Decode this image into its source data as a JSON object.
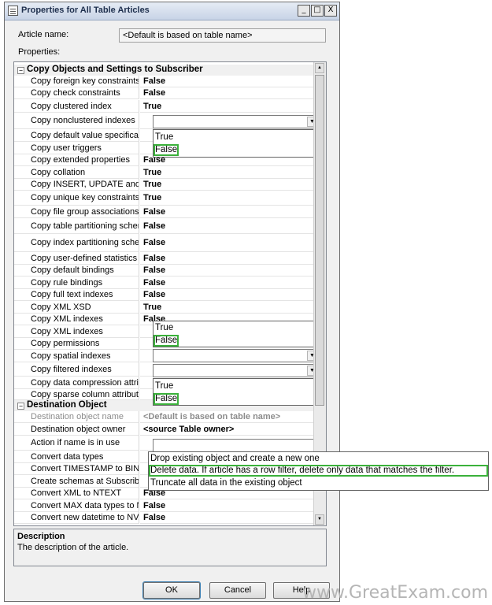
{
  "window": {
    "title": "Properties for All Table Articles",
    "caption_buttons": [
      "_",
      "□",
      "X"
    ]
  },
  "article_name": {
    "label": "Article name:",
    "value": "<Default is based on table name>"
  },
  "properties_label": "Properties:",
  "categories": [
    {
      "name": "Copy Objects and Settings to Subscriber",
      "toggle": "⊟"
    },
    {
      "name": "Destination Object",
      "toggle": "⊟"
    }
  ],
  "copy_rows": [
    {
      "name": "Copy foreign key constraints",
      "value": "False"
    },
    {
      "name": "Copy check constraints",
      "value": "False"
    },
    {
      "name": "Copy clustered index",
      "value": "True"
    },
    {
      "name": "Copy nonclustered indexes",
      "value": ""
    },
    {
      "name": "Copy default value specifications",
      "value": ""
    },
    {
      "name": "Copy user triggers",
      "value": ""
    },
    {
      "name": "Copy extended properties",
      "value": "False"
    },
    {
      "name": "Copy collation",
      "value": "True"
    },
    {
      "name": "Copy INSERT, UPDATE and DELETE",
      "value": "True"
    },
    {
      "name": "Copy unique key constraints",
      "value": "True"
    },
    {
      "name": "Copy file group associations",
      "value": "False"
    },
    {
      "name": "Copy table partitioning schemes",
      "value": "False"
    },
    {
      "name": "Copy index partitioning schemes",
      "value": "False"
    },
    {
      "name": "Copy user-defined statistics",
      "value": "False"
    },
    {
      "name": "Copy default bindings",
      "value": "False"
    },
    {
      "name": "Copy rule bindings",
      "value": "False"
    },
    {
      "name": "Copy full text indexes",
      "value": "False"
    },
    {
      "name": "Copy XML XSD",
      "value": "True"
    },
    {
      "name": "Copy XML indexes",
      "value": "False"
    },
    {
      "name": "Copy XML indexes",
      "value": ""
    },
    {
      "name": "Copy permissions",
      "value": ""
    },
    {
      "name": "Copy spatial indexes",
      "value": ""
    },
    {
      "name": "Copy filtered indexes",
      "value": ""
    },
    {
      "name": "Copy data compression attributes",
      "value": ""
    },
    {
      "name": "Copy sparse column attribute",
      "value": ""
    }
  ],
  "dest_rows": [
    {
      "name": "Destination object name",
      "value": "<Default is based on table name>"
    },
    {
      "name": "Destination object owner",
      "value": "<source Table owner>"
    },
    {
      "name": "Action if name is in use",
      "value": ""
    },
    {
      "name": "Convert data types",
      "value": ""
    },
    {
      "name": "Convert TIMESTAMP to BINARY",
      "value": ""
    },
    {
      "name": "Create schemas at Subscriber",
      "value": ""
    },
    {
      "name": "Convert XML to NTEXT",
      "value": "False"
    },
    {
      "name": "Convert MAX data types to NTEXT",
      "value": "False"
    },
    {
      "name": "Convert new datetime to NVARCHAR",
      "value": "False"
    }
  ],
  "bool_options": [
    "True",
    "False"
  ],
  "action_options": [
    "Drop existing object and create a new one",
    "Delete data. If article has a row filter, delete only data that matches the filter.",
    "Truncate all data in the existing object"
  ],
  "description": {
    "title": "Description",
    "text": "The description of the article."
  },
  "buttons": {
    "ok": "OK",
    "cancel": "Cancel",
    "help": "Help"
  },
  "scroll_arrows": {
    "up": "▲",
    "down": "▼"
  },
  "dropdown_arrow": "▼",
  "watermark": "www.GreatExam.com",
  "colors": {
    "selection_highlight": "#3bb13b",
    "titlebar": "#c7d3e6"
  }
}
